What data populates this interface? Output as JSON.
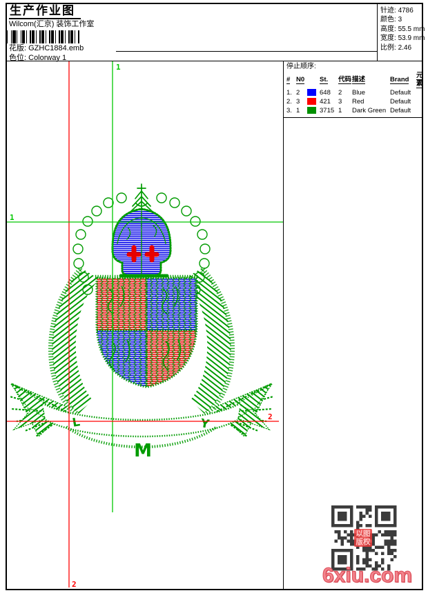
{
  "header": {
    "title": "生产作业图",
    "company": "Wilcom(汇京) 装饰工作室",
    "pattern_label": "花版:",
    "pattern_value": "GZHC1884.emb",
    "colorway_label": "色位:",
    "colorway_value": "Colorway 1"
  },
  "info": {
    "lines": [
      {
        "label": "针迹:",
        "value": "4786"
      },
      {
        "label": "颜色:",
        "value": "3"
      },
      {
        "label": "高度:",
        "value": "55.5 mm"
      },
      {
        "label": "宽度:",
        "value": "53.9 mm"
      },
      {
        "label": "比例:",
        "value": "2.46"
      }
    ]
  },
  "stop_sequence": {
    "title": "停止顺序:",
    "columns": [
      "#",
      "N0",
      "St.",
      "代码",
      "描述",
      "Brand",
      "元素"
    ],
    "rows": [
      {
        "idx": "1.",
        "n0": "2",
        "swatch": "#0000ff",
        "st": "648",
        "code": "2",
        "desc": "Blue",
        "brand": "Default",
        "element": ""
      },
      {
        "idx": "2.",
        "n0": "3",
        "swatch": "#ff0000",
        "st": "421",
        "code": "3",
        "desc": "Red",
        "brand": "Default",
        "element": ""
      },
      {
        "idx": "3.",
        "n0": "1",
        "swatch": "#009000",
        "st": "3715",
        "code": "1",
        "desc": "Dark Green",
        "brand": "Default",
        "element": ""
      }
    ]
  },
  "guides": {
    "start_label": "1",
    "end_label": "2",
    "start_color": "#00c800",
    "end_color": "#ff0000"
  },
  "design": {
    "colors": {
      "green": "#009b00",
      "blue": "#0000e8",
      "red": "#e80000"
    },
    "ribbon_letters": {
      "left": "L",
      "center": "M",
      "right": "Y"
    }
  },
  "watermark": {
    "site": "6xiu.com",
    "seal_text": "以图版权"
  }
}
